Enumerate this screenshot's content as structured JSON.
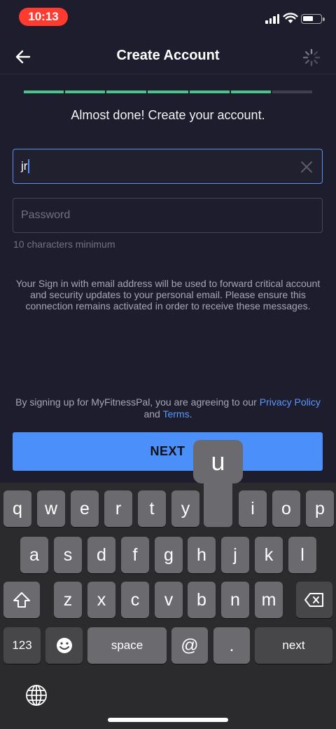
{
  "status_bar": {
    "time": "10:13",
    "time_color": "#ff3b30"
  },
  "header": {
    "title": "Create Account",
    "back_icon": "arrow-left-icon",
    "loading_icon": "spinner-icon"
  },
  "progress": {
    "completed_steps": 6,
    "total_steps": 7,
    "done_color": "#49c48a"
  },
  "subtitle": "Almost done! Create your account.",
  "email_field": {
    "value": "jr"
  },
  "password_field": {
    "placeholder": "Password"
  },
  "password_hint": "10 characters minimum",
  "info_text": "Your Sign in with email address will be used to forward critical account and security updates to your personal email. Please ensure this connection remains activated in order to receive these messages.",
  "terms": {
    "prefix": "By signing up for MyFitnessPal, you are agreeing to our ",
    "privacy_link": "Privacy Policy",
    "and": " and ",
    "terms_link": "Terms",
    "suffix": "."
  },
  "next_button": {
    "label": "NEXT",
    "color": "#4b8ffa"
  },
  "keyboard": {
    "popup_key": "u",
    "row1": [
      "q",
      "w",
      "e",
      "r",
      "t",
      "y",
      "u",
      "i",
      "o",
      "p"
    ],
    "row2": [
      "a",
      "s",
      "d",
      "f",
      "g",
      "h",
      "j",
      "k",
      "l"
    ],
    "row3": [
      "z",
      "x",
      "c",
      "v",
      "b",
      "n",
      "m"
    ],
    "numbers_label": "123",
    "space_label": "space",
    "at_label": "@",
    "dot_label": ".",
    "next_label": "next",
    "shift_icon": "shift-icon",
    "backspace_icon": "backspace-icon",
    "emoji_icon": "emoji-icon",
    "globe_icon": "globe-icon"
  }
}
